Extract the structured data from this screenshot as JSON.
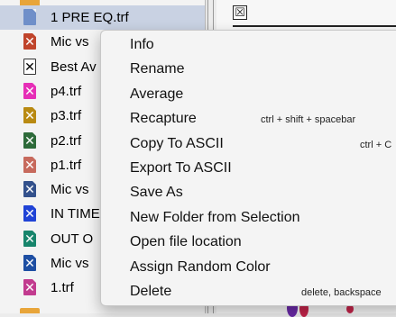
{
  "sidebar": {
    "files": [
      {
        "name": "1 PRE EQ.trf",
        "icon": "document-icon",
        "selected": true
      },
      {
        "name": "Mic vs",
        "icon": "x-file-icon",
        "color": "#c0442b"
      },
      {
        "name": "Best Av",
        "icon": "x-file-icon",
        "color": "#ffffff"
      },
      {
        "name": "p4.trf",
        "icon": "x-file-icon",
        "color": "#e62fb7"
      },
      {
        "name": "p3.trf",
        "icon": "x-file-icon",
        "color": "#b98a12"
      },
      {
        "name": "p2.trf",
        "icon": "x-file-icon",
        "color": "#2e6b3a"
      },
      {
        "name": "p1.trf",
        "icon": "x-file-icon",
        "color": "#c76a5d"
      },
      {
        "name": "Mic vs",
        "icon": "x-file-icon",
        "color": "#33518c"
      },
      {
        "name": "IN TIME",
        "icon": "x-file-icon",
        "color": "#2043d6"
      },
      {
        "name": "OUT O",
        "icon": "x-file-icon",
        "color": "#17856c"
      },
      {
        "name": "Mic vs",
        "icon": "x-file-icon",
        "color": "#1e4fa3"
      },
      {
        "name": "1.trf",
        "icon": "x-file-icon",
        "color": "#c23b8f"
      }
    ]
  },
  "context_menu": {
    "items": [
      {
        "label": "Info",
        "shortcut": ""
      },
      {
        "label": "Rename",
        "shortcut": ""
      },
      {
        "label": "Average",
        "shortcut": ""
      },
      {
        "label": "Recapture",
        "shortcut": "ctrl + shift + spacebar"
      },
      {
        "label": "Copy To ASCII",
        "shortcut": "ctrl + C"
      },
      {
        "label": "Export To ASCII",
        "shortcut": ""
      },
      {
        "label": "Save As",
        "shortcut": ""
      },
      {
        "label": "New Folder from Selection",
        "shortcut": ""
      },
      {
        "label": "Open file location",
        "shortcut": ""
      },
      {
        "label": "Assign Random Color",
        "shortcut": ""
      },
      {
        "label": "Delete",
        "shortcut": "delete, backspace"
      }
    ]
  },
  "right_pane": {
    "close_icon": "close-box-icon",
    "close_glyph": "☒"
  }
}
